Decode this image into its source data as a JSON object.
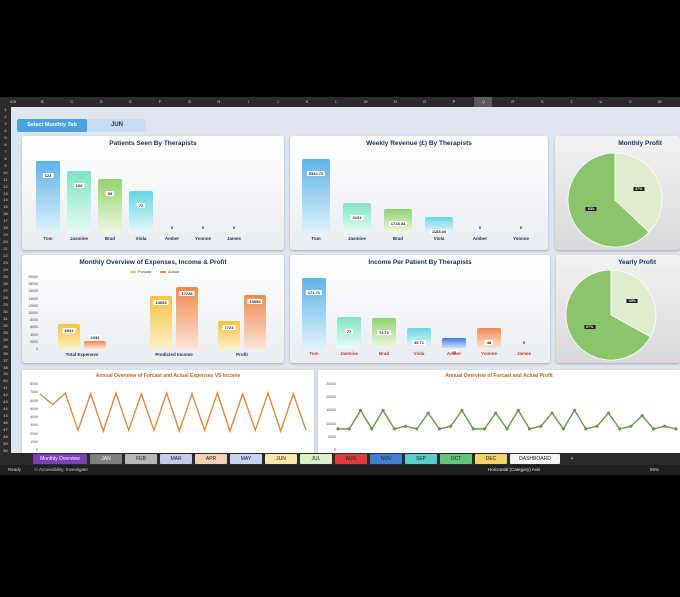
{
  "column_headers": [
    "A B",
    "B",
    "C",
    "D",
    "E",
    "F",
    "G",
    "H",
    "I",
    "J",
    "K",
    "L",
    "M",
    "N",
    "O",
    "P",
    "Q",
    "R",
    "S",
    "T",
    "U",
    "V",
    "W"
  ],
  "row_headers": [
    "1",
    "2",
    "3",
    "4",
    "5",
    "6",
    "7",
    "8",
    "9",
    "10",
    "11",
    "12",
    "13",
    "14",
    "15",
    "16",
    "17",
    "18",
    "19",
    "20",
    "21",
    "22",
    "23",
    "24",
    "25",
    "26",
    "27",
    "28",
    "29",
    "30",
    "31",
    "32",
    "33",
    "34",
    "35",
    "36",
    "37",
    "38",
    "39",
    "40",
    "41",
    "42",
    "43",
    "44",
    "45",
    "46",
    "47",
    "48",
    "49",
    "50"
  ],
  "selector": {
    "button_label": "Select Monthly Tab",
    "value": "JUN"
  },
  "panels": {
    "patients": {
      "title": "Patients Seen By Therapists"
    },
    "weekly": {
      "title": "Weekly Revenue (£) By Therapists"
    },
    "monthly_profit": {
      "title": "Monthly Profit"
    },
    "yearly_profit": {
      "title": "Yearly Profit"
    },
    "overview": {
      "title": "Monthly Overview of Expenses, Income & Profit",
      "legend_forecast": "Forcast",
      "legend_actual": "Actual"
    },
    "income_per_patient": {
      "title": "Income Per Patient By Therapists"
    },
    "annual_expenses": {
      "title": "Annual Overview of Forcast and Actual Expenses VS Income"
    },
    "annual_profit": {
      "title": "Annual Overview of Forcast and Actual Profit"
    }
  },
  "chart_data": [
    {
      "type": "bar",
      "title": "Patients Seen By Therapists",
      "categories": [
        "Tom",
        "Jasmine",
        "Brad",
        "Viola",
        "Amber",
        "Yvonne",
        "James"
      ],
      "values": [
        123,
        106,
        93,
        72,
        0,
        0,
        0
      ],
      "value_labels": [
        "123",
        "106",
        "93",
        "72",
        "0",
        "0",
        "0"
      ]
    },
    {
      "type": "bar",
      "title": "Weekly Revenue (£) By Therapists",
      "categories": [
        "Tom",
        "Jasmine",
        "Brad",
        "Viola",
        "Amber",
        "Yvonne"
      ],
      "values": [
        5344.72,
        2131,
        1718.34,
        1183.04,
        0,
        0
      ],
      "value_labels": [
        "5344.72",
        "2131",
        "1718.34",
        "1183.04",
        "0",
        "0"
      ]
    },
    {
      "type": "pie",
      "title": "Monthly Profit",
      "values": [
        63,
        37
      ],
      "labels": [
        "63%",
        "37%"
      ],
      "colors": [
        "#8bc56b",
        "#dfeccf"
      ]
    },
    {
      "type": "pie",
      "title": "Yearly Profit",
      "values": [
        67,
        33
      ],
      "labels": [
        "67%",
        "33%"
      ],
      "colors": [
        "#8bc56b",
        "#dfeccf"
      ]
    },
    {
      "type": "bar",
      "title": "Monthly Overview of Expenses, Income & Profit",
      "categories": [
        "Total Expenses",
        "Predicted Income",
        "Profit"
      ],
      "series": [
        {
          "name": "Forcast",
          "values": [
            6931,
            14653,
            7721
          ],
          "color": "#f5c242"
        },
        {
          "name": "Actual",
          "values": [
            2332,
            17226,
            15054
          ],
          "color": "#f08a50"
        }
      ],
      "yticks": [
        "20000",
        "18000",
        "16000",
        "14000",
        "12000",
        "10000",
        "8000",
        "6000",
        "4000",
        "2000",
        "0"
      ],
      "ylim": [
        0,
        20000
      ]
    },
    {
      "type": "bar",
      "title": "Income Per Patient By Therapists",
      "categories": [
        "Tom",
        "Jasmine",
        "Brad",
        "Viola",
        "Amber",
        "Yvonne",
        "James"
      ],
      "values": [
        171.71,
        77,
        74.71,
        49.71,
        24,
        48,
        0
      ],
      "value_labels": [
        "171.71",
        "77",
        "74.71",
        "49.71",
        "24",
        "48",
        "0"
      ]
    },
    {
      "type": "line",
      "title": "Annual Overview of Forcast and Actual Expenses VS Income",
      "yticks": [
        "8000",
        "7000",
        "6000",
        "5000",
        "4000",
        "3000",
        "2000",
        "1000",
        "0"
      ],
      "values": [
        6800,
        5500,
        6900,
        2400,
        6800,
        2300,
        6900,
        2400,
        6800,
        2400,
        6900,
        2300,
        6800,
        2400,
        6900,
        2300,
        6800,
        2400,
        6900,
        2300,
        6800,
        2400
      ],
      "ylim": [
        0,
        8000
      ],
      "color": "#e0893a"
    },
    {
      "type": "line",
      "title": "Annual Overview of Forcast and Actual Profit",
      "yticks": [
        "25000",
        "20000",
        "15000",
        "10000",
        "5000",
        "0"
      ],
      "values": [
        8000,
        8000,
        15000,
        8000,
        15000,
        8000,
        9000,
        8000,
        14000,
        8000,
        9000,
        15000,
        8000,
        8000,
        14000,
        8000,
        15000,
        8000,
        9000,
        14000,
        8000,
        15000,
        8000,
        9000,
        14000,
        8000,
        9000,
        13000,
        8000,
        9000,
        8000
      ],
      "ylim": [
        0,
        25000
      ],
      "color": "#6a9a45"
    }
  ],
  "sheet_tabs": [
    {
      "label": "Monthly Overview",
      "color": "#7b3fb5",
      "text": "#ffffff"
    },
    {
      "label": "JAN",
      "color": "#7f7f7f",
      "text": "#ffffff"
    },
    {
      "label": "FEB",
      "color": "#b7b7b7",
      "text": "#222222"
    },
    {
      "label": "MAR",
      "color": "#c5cbe8",
      "text": "#222222"
    },
    {
      "label": "APR",
      "color": "#f8cdb8",
      "text": "#222222"
    },
    {
      "label": "MAY",
      "color": "#c7d3f0",
      "text": "#222222"
    },
    {
      "label": "JUN",
      "color": "#f7e7a8",
      "text": "#222222"
    },
    {
      "label": "JUL",
      "color": "#d9f0c8",
      "text": "#222222"
    },
    {
      "label": "AUG",
      "color": "#e23b3b",
      "text": "#222222"
    },
    {
      "label": "NOV",
      "color": "#3f7fd6",
      "text": "#222222"
    },
    {
      "label": "SEP",
      "color": "#56d0c8",
      "text": "#222222"
    },
    {
      "label": "OCT",
      "color": "#63c47c",
      "text": "#222222"
    },
    {
      "label": "DEC",
      "color": "#f2d26a",
      "text": "#222222"
    },
    {
      "label": "DASHBOARD",
      "color": "#f4f4f4",
      "text": "#222222"
    }
  ],
  "add_sheet_label": "+",
  "status": {
    "ready": "Ready",
    "accessibility": "Accessibility: Investigate",
    "axis_name": "Horizontal (Category) Axis",
    "zoom": "85%"
  }
}
